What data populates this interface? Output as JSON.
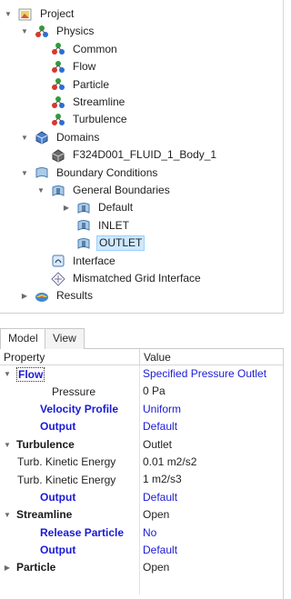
{
  "tree": {
    "items": [
      {
        "label": "Project",
        "icon": "project-icon"
      },
      {
        "label": "Physics",
        "icon": "physics-icon"
      },
      {
        "label": "Common",
        "icon": "physics-node-icon"
      },
      {
        "label": "Flow",
        "icon": "physics-node-icon"
      },
      {
        "label": "Particle",
        "icon": "physics-node-icon"
      },
      {
        "label": "Streamline",
        "icon": "physics-node-icon"
      },
      {
        "label": "Turbulence",
        "icon": "physics-node-icon"
      },
      {
        "label": "Domains",
        "icon": "domains-icon"
      },
      {
        "label": "F324D001_FLUID_1_Body_1",
        "icon": "domain-body-icon"
      },
      {
        "label": "Boundary Conditions",
        "icon": "boundary-conditions-icon"
      },
      {
        "label": "General Boundaries",
        "icon": "boundary-group-icon"
      },
      {
        "label": "Default",
        "icon": "boundary-icon"
      },
      {
        "label": "INLET",
        "icon": "boundary-icon"
      },
      {
        "label": "OUTLET",
        "icon": "boundary-icon"
      },
      {
        "label": "Interface",
        "icon": "interface-icon"
      },
      {
        "label": "Mismatched Grid Interface",
        "icon": "mismatched-interface-icon"
      },
      {
        "label": "Results",
        "icon": "results-icon"
      }
    ],
    "selected": "OUTLET"
  },
  "tabs": {
    "model": "Model",
    "view": "View"
  },
  "grid": {
    "header_property": "Property",
    "header_value": "Value",
    "rows": [
      {
        "property": "Flow",
        "value": "Specified Pressure Outlet"
      },
      {
        "property": "Pressure",
        "value": "0 Pa"
      },
      {
        "property": "Velocity Profile",
        "value": "Uniform"
      },
      {
        "property": "Output",
        "value": "Default"
      },
      {
        "property": "Turbulence",
        "value": "Outlet"
      },
      {
        "property": "Turb. Kinetic Energy",
        "value": "0.01 m2/s2"
      },
      {
        "property": "Turb. Kinetic Energy",
        "value": "1 m2/s3"
      },
      {
        "property": "Output",
        "value": "Default"
      },
      {
        "property": "Streamline",
        "value": "Open"
      },
      {
        "property": "Release Particle",
        "value": "No"
      },
      {
        "property": "Output",
        "value": "Default"
      },
      {
        "property": "Particle",
        "value": "Open"
      }
    ]
  },
  "colors": {
    "link_blue": "#1a1ad6",
    "selection_bg": "#cde8ff",
    "selection_border": "#99d1ff",
    "physics_red": "#d8382a",
    "physics_green": "#2e9d3a",
    "physics_blue": "#2a6fd6",
    "boundary_blue": "#3b7bd0"
  }
}
